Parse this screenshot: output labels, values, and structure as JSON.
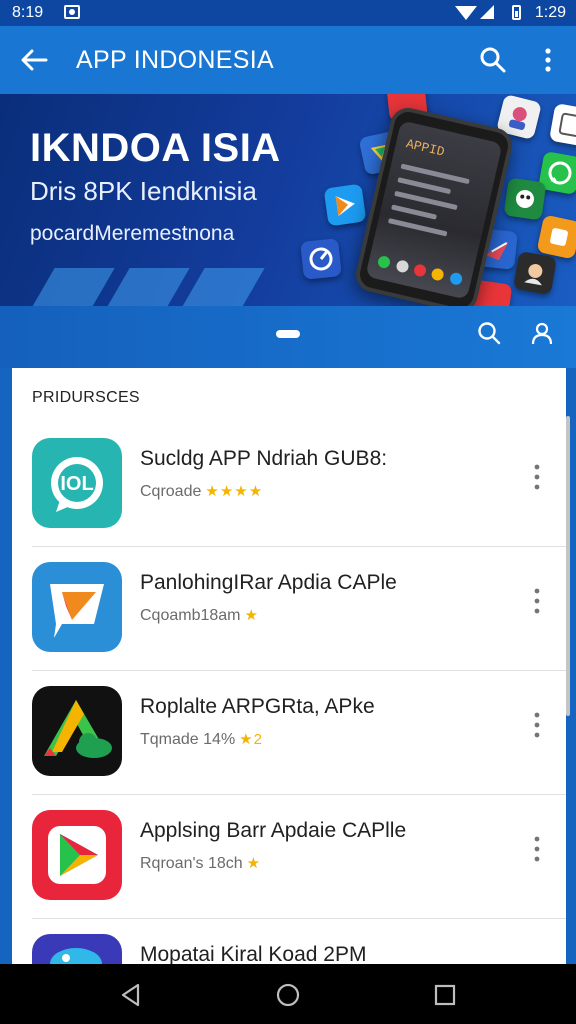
{
  "status_bar": {
    "time": "8:19",
    "clock_right": "1:29"
  },
  "app_bar": {
    "title": "APP INDONESIA",
    "back_icon": "arrow-left-icon",
    "search_icon": "search-icon",
    "more_icon": "more-vert-icon"
  },
  "banner": {
    "headline": "IKNDOA ISIA",
    "subheadline": "Dris 8PK Iendknisia",
    "tagline": "pocardMeremestnona",
    "phone_screen_text": "APPID"
  },
  "section": {
    "title": "PRIDURSCES"
  },
  "apps": [
    {
      "name": "Sucldg APP Ndriah GUB8:",
      "meta": "Cqroade",
      "stars": "★★★★",
      "icon": "chat-bubble-icon"
    },
    {
      "name": "PanlohingIRar Apdia CAPle",
      "meta": "Cqoamb18am",
      "stars": "★",
      "icon": "paper-plane-icon"
    },
    {
      "name": "Roplalte ARPGRta, APke",
      "meta": "Tqmade 14%",
      "stars": "★2",
      "icon": "drive-cloud-icon"
    },
    {
      "name": "Applsing Barr Apdaie CAPlle",
      "meta": "Rqroan's 18ch",
      "stars": "★",
      "icon": "play-triangle-icon"
    },
    {
      "name": "Mopatai Kiral Koad 2PM",
      "meta": "",
      "stars": "",
      "icon": "bird-icon"
    }
  ],
  "colors": {
    "app_bar": "#1976d2",
    "status_bar": "#0d47a1",
    "star": "#f4b400",
    "icon_teal": "#26b5b0",
    "icon_blue": "#2a8fd6",
    "icon_black": "#111111",
    "icon_red": "#e8253a",
    "icon_indigo": "#3a3ab8"
  },
  "nav_bar": {
    "back": "triangle-back-icon",
    "home": "circle-home-icon",
    "recents": "square-recents-icon"
  }
}
